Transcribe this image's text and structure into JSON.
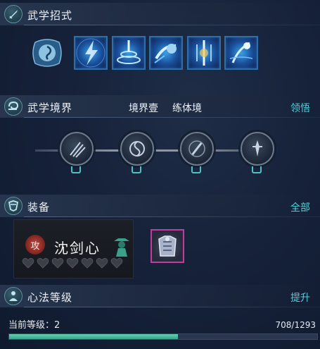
{
  "sections": {
    "skills": {
      "title": "武学招式"
    },
    "realm": {
      "title": "武学境界",
      "level_name": "境界壹",
      "realm_name": "练体境",
      "action": "领悟"
    },
    "equipment": {
      "title": "装备",
      "action": "全部",
      "character": {
        "badge": "攻",
        "name": "沈剑心",
        "hearts_total": 7,
        "hearts_filled": 0
      }
    },
    "heart_method": {
      "title": "心法等级",
      "action": "提升",
      "level_label": "当前等级：2",
      "progress_text": "708/1293",
      "progress_fraction": 0.5476
    }
  },
  "colors": {
    "accent": "#4fd0d8",
    "skill_border": "#2f6fa8",
    "gear_border": "#c23c9c",
    "progress_fill": "#4fb89c"
  },
  "skill_icons": [
    "swirl-skill-icon",
    "lightning-skill-icon",
    "tornado-skill-icon",
    "fist-skill-icon",
    "sword-rain-skill-icon",
    "leap-skill-icon"
  ],
  "realm_nodes": [
    "claw-realm-icon",
    "yin-yang-realm-icon",
    "brush-realm-icon",
    "dagger-realm-icon"
  ]
}
